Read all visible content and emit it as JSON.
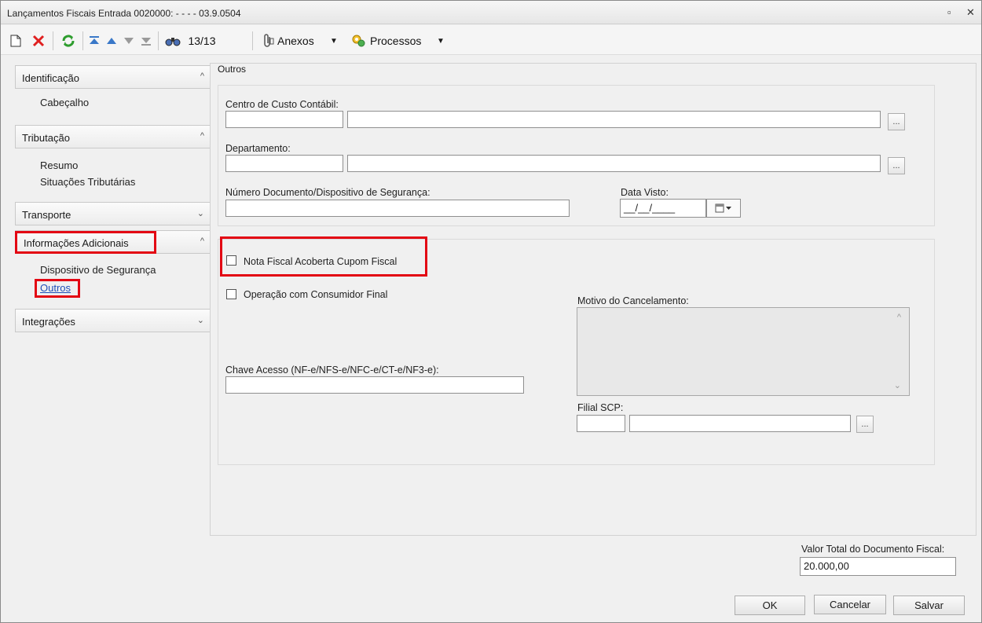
{
  "window": {
    "title": "Lançamentos Fiscais Entrada 0020000: - - - - 03.9.0504",
    "restore_glyph": "▫",
    "close_glyph": "✕"
  },
  "toolbar": {
    "record_counter": "13/13",
    "anexos_label": "Anexos",
    "processos_label": "Processos",
    "icons": [
      "new-icon",
      "delete-icon",
      "refresh-icon",
      "first-icon",
      "prev-icon",
      "next-icon",
      "last-icon",
      "search-icon",
      "attachment-icon",
      "process-icon"
    ]
  },
  "sidebar": {
    "groups": [
      {
        "label": "Identificação",
        "expanded": true,
        "items": [
          "Cabeçalho"
        ]
      },
      {
        "label": "Tributação",
        "expanded": true,
        "items": [
          "Resumo",
          "Situações Tributárias"
        ]
      },
      {
        "label": "Transporte",
        "expanded": false,
        "items": []
      },
      {
        "label": "Informações Adicionais",
        "expanded": true,
        "items": [
          "Dispositivo de Segurança",
          "Outros"
        ]
      },
      {
        "label": "Integrações",
        "expanded": false,
        "items": []
      }
    ],
    "chev_up": "^",
    "chev_down": "⌄"
  },
  "main": {
    "section_title": "Outros",
    "centro_custo_label": "Centro de Custo Contábil:",
    "departamento_label": "Departamento:",
    "numero_doc_label": "Número Documento/Dispositivo de Segurança:",
    "data_visto_label": "Data Visto:",
    "data_visto_value": "__/__/____",
    "nota_fiscal_label": "Nota Fiscal  Acoberta Cupom Fiscal",
    "consumidor_final_label": "Operação com Consumidor Final",
    "motivo_label": "Motivo do Cancelamento:",
    "chave_acesso_label": "Chave Acesso (NF-e/NFS-e/NFC-e/CT-e/NF3-e):",
    "filial_scp_label": "Filial SCP:",
    "browse_label": "...",
    "valor_total_label": "Valor Total do Documento Fiscal:",
    "valor_total_value": "20.000,00"
  },
  "buttons": {
    "ok": "OK",
    "cancelar": "Cancelar",
    "salvar": "Salvar"
  },
  "colors": {
    "highlight": "#e30613",
    "delete": "#e02020",
    "refresh": "#2e9d2e",
    "nav": "#3a78c8",
    "link": "#1f4fb8"
  }
}
